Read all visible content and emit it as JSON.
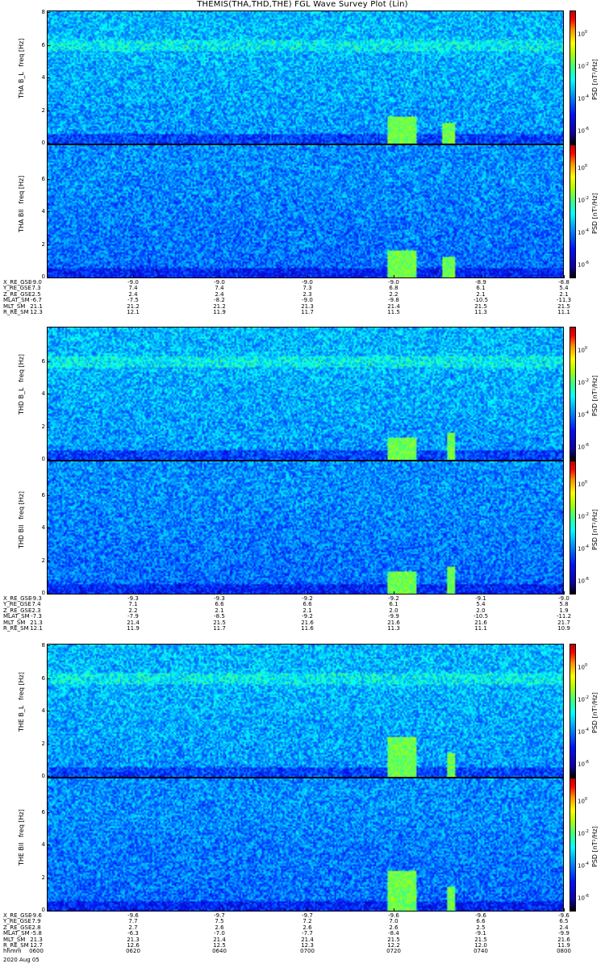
{
  "title": "THEMIS(THA,THD,THE) FGL Wave Survey Plot (Lin)",
  "date": "2020 Aug 05",
  "colors": {
    "background": "#ffffff",
    "axis": "#000000"
  },
  "chart_data": [
    {
      "type": "heatmap",
      "probe": "THA",
      "panels": [
        {
          "name": "THA B_L",
          "ylabel": "THA B_L",
          "yunit": "freq [Hz]",
          "ylim": [
            0,
            8
          ],
          "yticks": [
            "0",
            "2",
            "4",
            "6",
            "8"
          ],
          "zlabel": "PSD [nT²/Hz]",
          "ztick_exps": [
            "0",
            "-2",
            "-4",
            "-6"
          ],
          "zscale": "log"
        },
        {
          "name": "THA Bll",
          "ylabel": "THA Bll",
          "yunit": "freq [Hz]",
          "ylim": [
            0,
            8
          ],
          "yticks": [
            "0",
            "2",
            "4",
            "6"
          ],
          "zlabel": "PSD [nT²/Hz]",
          "ztick_exps": [
            "0",
            "-2",
            "-4",
            "-6"
          ],
          "zscale": "log"
        }
      ],
      "ephemeris": {
        "labels": [
          "X_RE_GSE",
          "Y_RE_GSE",
          "Z_RE_GSE",
          "MLAT_SM",
          "MLT_SM",
          "R_RE_SM"
        ],
        "values": [
          [
            "-9.0",
            "-9.0",
            "-9.0",
            "-9.0",
            "-9.0",
            "-8.9",
            "-8.8"
          ],
          [
            "7.3",
            "7.4",
            "7.4",
            "7.3",
            "6.8",
            "6.1",
            "5.4"
          ],
          [
            "2.5",
            "2.4",
            "2.4",
            "2.3",
            "2.2",
            "2.1",
            "2.1"
          ],
          [
            "-6.7",
            "-7.5",
            "-8.2",
            "-9.0",
            "-9.8",
            "-10.5",
            "-11.3"
          ],
          [
            "21.1",
            "21.2",
            "21.2",
            "21.3",
            "21.4",
            "21.5",
            "21.5"
          ],
          [
            "12.3",
            "12.1",
            "11.9",
            "11.7",
            "11.5",
            "11.3",
            "11.1"
          ]
        ]
      },
      "bursts": [
        {
          "t_start": "0719",
          "t_end": "0726",
          "f_max_hz": 1.6
        },
        {
          "t_start": "0732",
          "t_end": "0735",
          "f_max_hz": 1.2
        }
      ]
    },
    {
      "type": "heatmap",
      "probe": "THD",
      "panels": [
        {
          "name": "THD B_L",
          "ylabel": "THD B_L",
          "yunit": "freq [Hz]",
          "ylim": [
            0,
            8
          ],
          "yticks": [
            "0",
            "2",
            "4",
            "6"
          ],
          "zlabel": "PSD [nT²/Hz]",
          "ztick_exps": [
            "0",
            "-2",
            "-4",
            "-6"
          ],
          "zscale": "log"
        },
        {
          "name": "THD Bll",
          "ylabel": "THD Bll",
          "yunit": "freq [Hz]",
          "ylim": [
            0,
            8
          ],
          "yticks": [
            "0",
            "2",
            "4",
            "6"
          ],
          "zlabel": "PSD [nT²/Hz]",
          "ztick_exps": [
            "0",
            "-2",
            "-4",
            "-6"
          ],
          "zscale": "log"
        }
      ],
      "ephemeris": {
        "labels": [
          "X_RE_GSE",
          "Y_RE_GSE",
          "Z_RE_GSE",
          "MLAT_SM",
          "MLT_SM",
          "R_RE_SM"
        ],
        "values": [
          [
            "-9.3",
            "-9.3",
            "-9.3",
            "-9.2",
            "-9.2",
            "-9.1",
            "-9.0"
          ],
          [
            "7.4",
            "7.1",
            "6.6",
            "6.6",
            "6.1",
            "5.4",
            "5.8"
          ],
          [
            "2.3",
            "2.2",
            "2.1",
            "2.1",
            "2.0",
            "2.0",
            "1.9"
          ],
          [
            "-7.3",
            "-7.9",
            "-8.5",
            "-9.2",
            "-9.9",
            "-10.5",
            "-11.2"
          ],
          [
            "21.3",
            "21.4",
            "21.5",
            "21.6",
            "21.6",
            "21.6",
            "21.7"
          ],
          [
            "12.1",
            "11.9",
            "11.7",
            "11.6",
            "11.3",
            "11.1",
            "10.9"
          ]
        ]
      },
      "bursts": [
        {
          "t_start": "0719",
          "t_end": "0726",
          "f_max_hz": 1.3
        },
        {
          "t_start": "0733",
          "t_end": "0735",
          "f_max_hz": 1.6
        }
      ]
    },
    {
      "type": "heatmap",
      "probe": "THE",
      "panels": [
        {
          "name": "THE B_L",
          "ylabel": "THE B_L",
          "yunit": "freq [Hz]",
          "ylim": [
            0,
            8
          ],
          "yticks": [
            "0",
            "2",
            "4",
            "6",
            "8"
          ],
          "zlabel": "PSD [nT²/Hz]",
          "ztick_exps": [
            "0",
            "-2",
            "-4",
            "-6"
          ],
          "zscale": "log"
        },
        {
          "name": "THE Bll",
          "ylabel": "THE Bll",
          "yunit": "freq [Hz]",
          "ylim": [
            0,
            8
          ],
          "yticks": [
            "0",
            "2",
            "4",
            "6"
          ],
          "zlabel": "PSD [nT²/Hz]",
          "ztick_exps": [
            "0",
            "-2",
            "-4",
            "-6"
          ],
          "zscale": "log"
        }
      ],
      "ephemeris": {
        "labels": [
          "X_RE_GSE",
          "Y_RE_GSE",
          "Z_RE_GSE",
          "MLAT_SM",
          "MLT_SM",
          "R_RE_SM",
          "hhmm"
        ],
        "values": [
          [
            "-9.6",
            "-9.6",
            "-9.7",
            "-9.7",
            "-9.6",
            "-9.6",
            "-9.6"
          ],
          [
            "7.9",
            "7.7",
            "7.5",
            "7.2",
            "7.0",
            "6.6",
            "6.5"
          ],
          [
            "2.8",
            "2.7",
            "2.6",
            "2.6",
            "2.6",
            "2.5",
            "2.4"
          ],
          [
            "-5.8",
            "-6.3",
            "-7.0",
            "-7.7",
            "-8.4",
            "-9.1",
            "-9.9"
          ],
          [
            "21.3",
            "21.3",
            "21.4",
            "21.4",
            "21.5",
            "21.5",
            "21.6"
          ],
          [
            "12.7",
            "12.6",
            "12.5",
            "12.3",
            "12.2",
            "12.0",
            "11.9"
          ],
          [
            "0600",
            "0620",
            "0640",
            "0700",
            "0720",
            "0740",
            "0800"
          ]
        ]
      },
      "bursts": [
        {
          "t_start": "0719",
          "t_end": "0726",
          "f_max_hz": 2.4
        },
        {
          "t_start": "0733",
          "t_end": "0735",
          "f_max_hz": 1.4
        }
      ]
    }
  ],
  "time_axis": {
    "start": "0600",
    "end": "0800"
  }
}
